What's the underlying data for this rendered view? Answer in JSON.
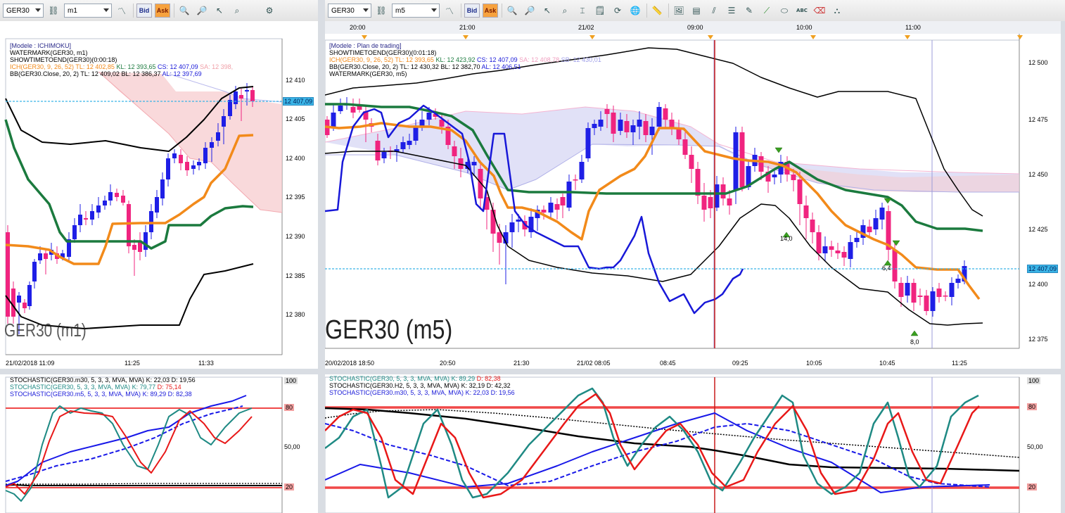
{
  "left_toolbar": {
    "symbol": "GER30",
    "timeframe": "m1",
    "bid_label": "Bid",
    "ask_label": "Ask"
  },
  "right_toolbar": {
    "symbol": "GER30",
    "timeframe": "m5",
    "bid_label": "Bid",
    "ask_label": "Ask",
    "text_tool": "ABC"
  },
  "left_chart": {
    "legend": {
      "model": "[Modele : ICHIMOKU]",
      "watermark": "WATERMARK(GER30, m1)",
      "showtime": "SHOWTIMETOEND(GER30)(0:00:18)",
      "ich_name": "ICH(GER30, 9, 26, 52)",
      "ich_tl": "TL: 12 402,85",
      "ich_kl": "KL: 12 393,65",
      "ich_cs": "CS: 12 407,09",
      "ich_sa": "SA: 12 398,",
      "bb_name": "BB(GER30.Close, 20, 2)",
      "bb_tl": "TL: 12 409,02",
      "bb_bl": "BL: 12 386,37",
      "bb_al": "AL: 12 397,69"
    },
    "price_ticks": [
      "12 410",
      "12 405",
      "12 400",
      "12 395",
      "12 390",
      "12 385",
      "12 380"
    ],
    "current_price": "12 407,09",
    "watermark": "GER30 (m1)",
    "time_ticks": [
      "21/02/2018 11:09",
      "11:25",
      "11:33"
    ]
  },
  "right_chart": {
    "top_time_ticks": [
      "20:00",
      "21:00",
      "21/02",
      "09:00",
      "10:00",
      "11:00"
    ],
    "legend": {
      "model": "[Modele : Plan de trading]",
      "showtime": "SHOWTIMETOEND(GER30)(0:01:18)",
      "ich_name": "ICH(GER30, 9, 26, 52)",
      "ich_tl": "TL: 12 393,65",
      "ich_kl": "KL: 12 423,92",
      "ich_cs": "CS: 12 407,09",
      "ich_sa": "SA: 12 408,78",
      "ich_sb": "SB: 12 430,01",
      "bb_name": "BB(GER30.Close, 20, 2)",
      "bb_tl": "TL: 12 430,32",
      "bb_bl": "BL: 12 382,70",
      "bb_al": "AL: 12 406,51",
      "watermark": "WATERMARK(GER30, m5)"
    },
    "price_ticks": [
      "12 500",
      "12 475",
      "12 450",
      "12 425",
      "12 400",
      "12 375"
    ],
    "current_price": "12 407,09",
    "watermark": "GER30 (m5)",
    "annotations": [
      "14,0",
      "6,4",
      "8,0"
    ],
    "time_ticks": [
      "20/02/2018 18:50",
      "20:50",
      "21:30",
      "21/02 08:05",
      "08:45",
      "09:25",
      "10:05",
      "10:45",
      "11:25"
    ]
  },
  "left_stoch": {
    "legend": [
      {
        "text": "STOCHASTIC(GER30.m30, 5, 3, 3, MVA, MVA)",
        "k": "K: 22,03",
        "d": "D: 19,56"
      },
      {
        "text": "STOCHASTIC(GER30, 5, 3, 3, MVA, MVA)",
        "k": "K: 79,77",
        "d": "D: 75,14"
      },
      {
        "text": "STOCHASTIC(GER30.m5, 5, 3, 3, MVA, MVA)",
        "k": "K: 89,29",
        "d": "D: 82,38"
      }
    ],
    "ticks": [
      "100",
      "80",
      "50,00",
      "20"
    ]
  },
  "right_stoch": {
    "legend": [
      {
        "text": "STOCHASTIC(GER30, 5, 3, 3, MVA, MVA)",
        "k": "K: 89,29",
        "d": "D: 82,38"
      },
      {
        "text": "STOCHASTIC(GER30.H2, 5, 3, 3, MVA, MVA)",
        "k": "K: 32,19",
        "d": "D: 42,32"
      },
      {
        "text": "STOCHASTIC(GER30.m30, 5, 3, 3, MVA, MVA)",
        "k": "K: 22,03",
        "d": "D: 19,56"
      }
    ],
    "ticks": [
      "100",
      "80",
      "50,00",
      "20"
    ]
  },
  "colors": {
    "bull_candle": "#1f1fe6",
    "bear_candle": "#f0247f",
    "tenkan": "#f28a1a",
    "kijun": "#1b7a3e",
    "chikou": "#1818d8",
    "bollinger": "#000000",
    "cloud_bear": "#f7c9cc",
    "cloud_bull": "#c8c8f0",
    "price_line": "#3ab4e6",
    "stoch_k": "#1f8a84",
    "stoch_d": "#e81818",
    "level_line": "#f04848",
    "time_marker": "#c81a1a"
  },
  "icons": [
    "chart-type-icon",
    "link-icon",
    "zoom-in-icon",
    "zoom-out-icon",
    "crosshair-icon",
    "trendline-icon",
    "eraser-icon",
    "settings-icon"
  ]
}
